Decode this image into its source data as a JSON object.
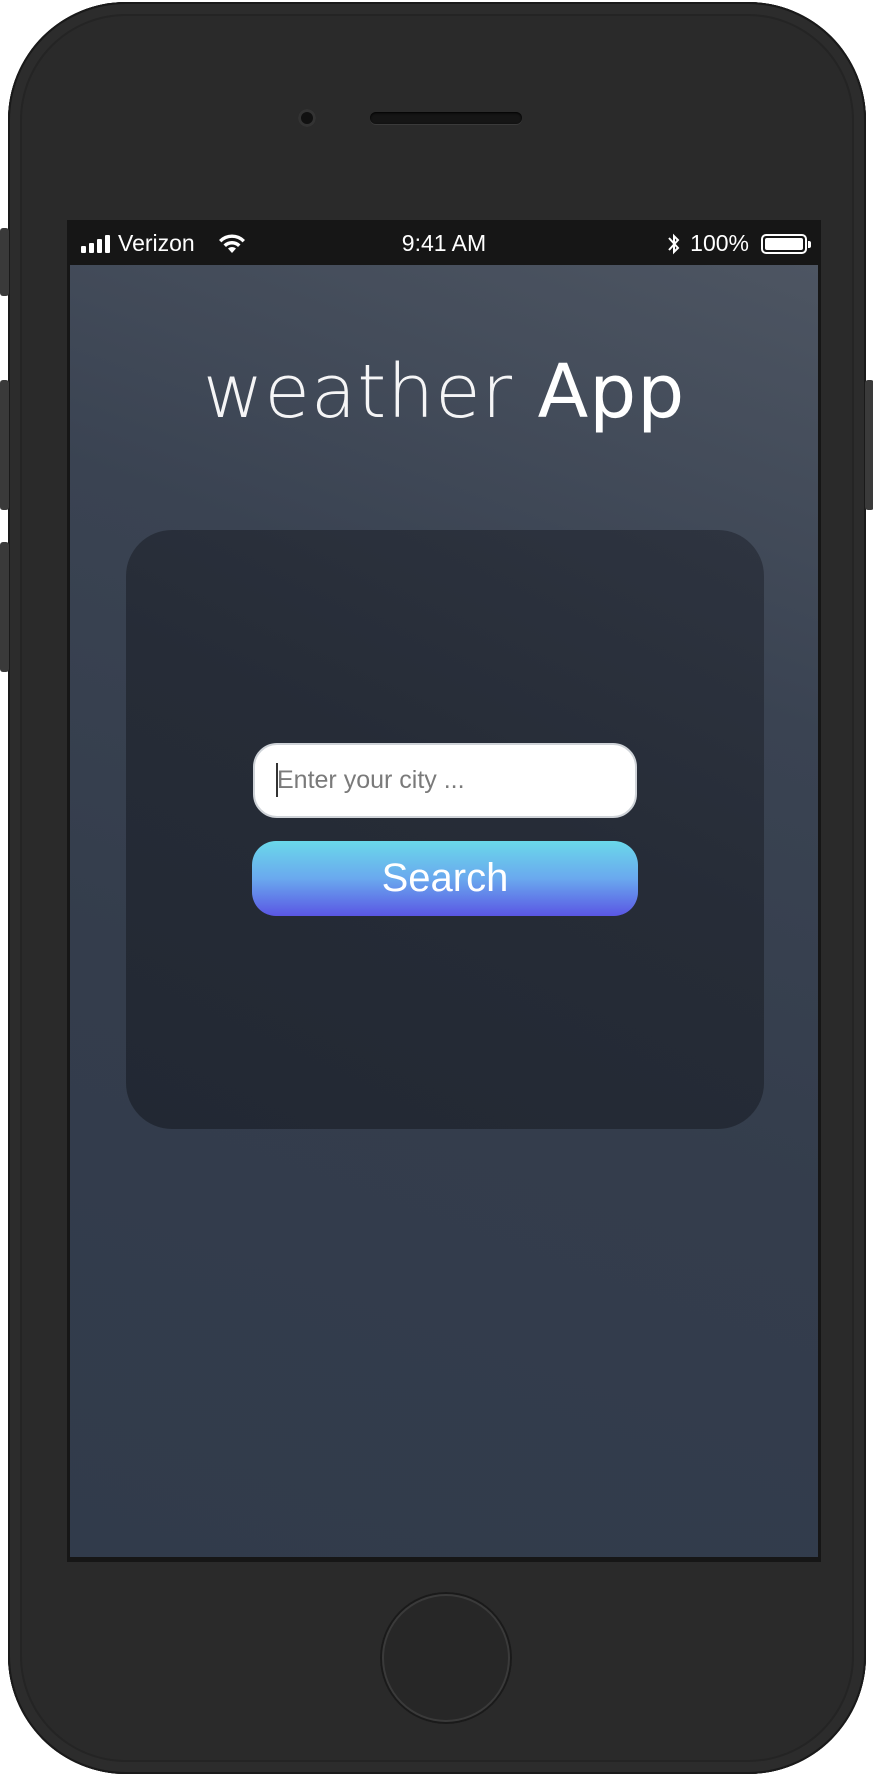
{
  "status_bar": {
    "carrier": "Verizon",
    "time": "9:41 AM",
    "battery": "100%",
    "icons": [
      "signal-icon",
      "wifi-icon",
      "bluetooth-icon",
      "battery-icon"
    ]
  },
  "app": {
    "title_light": "weather",
    "title_bold": "App"
  },
  "search": {
    "placeholder": "Enter your city ...",
    "value": "",
    "button_label": "Search"
  },
  "colors": {
    "screen_bg": "#343d4c",
    "card_bg": "#262c37",
    "button_gradient_top": "#6ad8ea",
    "button_gradient_bottom": "#5a56e4",
    "text": "#ffffff"
  }
}
